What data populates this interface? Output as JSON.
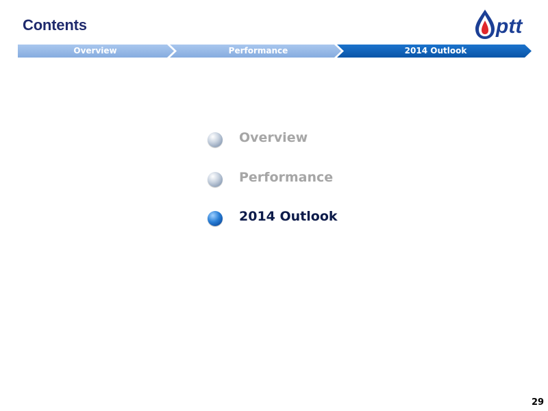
{
  "header": {
    "title": "Contents",
    "logo_text": "ptt"
  },
  "nav": {
    "steps": [
      {
        "label": "Overview",
        "state": "done"
      },
      {
        "label": "Performance",
        "state": "done"
      },
      {
        "label": "2014 Outlook",
        "state": "current"
      }
    ]
  },
  "toc": {
    "items": [
      {
        "label": "Overview",
        "active": false
      },
      {
        "label": "Performance",
        "active": false
      },
      {
        "label": "2014 Outlook",
        "active": true
      }
    ]
  },
  "footer": {
    "page_number": "29"
  },
  "colors": {
    "title": "#1f2a6d",
    "nav_inactive": "#8fb4e3",
    "nav_active": "#0b5eb8",
    "toc_inactive": "#a6a6a6",
    "toc_active": "#0d1b4a"
  }
}
